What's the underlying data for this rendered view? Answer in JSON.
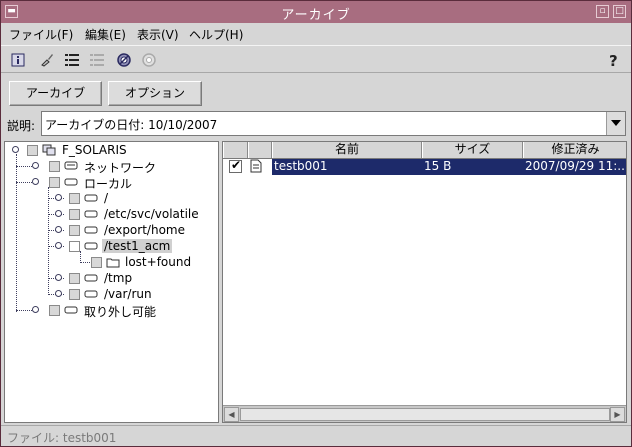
{
  "window": {
    "title": "アーカイブ"
  },
  "menubar": {
    "items": [
      "ファイル(F)",
      "編集(E)",
      "表示(V)",
      "ヘルプ(H)"
    ]
  },
  "toolbar": {
    "icons": [
      "info-icon",
      "brush-icon",
      "list-icon",
      "list-disabled-icon",
      "ring-icon",
      "disc-disabled-icon",
      "help-icon"
    ]
  },
  "buttons": {
    "archive": "アーカイブ",
    "options": "オプション"
  },
  "description": {
    "label": "説明:",
    "value": "アーカイブの日付: 10/10/2007"
  },
  "tree": {
    "root": "F_SOLARIS",
    "network": "ネットワーク",
    "local": "ローカル",
    "fs": [
      "/",
      "/etc/svc/volatile",
      "/export/home",
      "/test1_acm",
      "/tmp",
      "/var/run"
    ],
    "lostfound": "lost+found",
    "removable": "取り外し可能"
  },
  "table": {
    "headers": [
      "名前",
      "サイズ",
      "修正済み"
    ],
    "rows": [
      {
        "name": "testb001",
        "size": "15 B",
        "modified": "2007/09/29 11:..."
      }
    ]
  },
  "status": {
    "text": "ファイル: testb001"
  },
  "colors": {
    "titlebar": "#a86d80",
    "selection": "#1d2a6a"
  }
}
